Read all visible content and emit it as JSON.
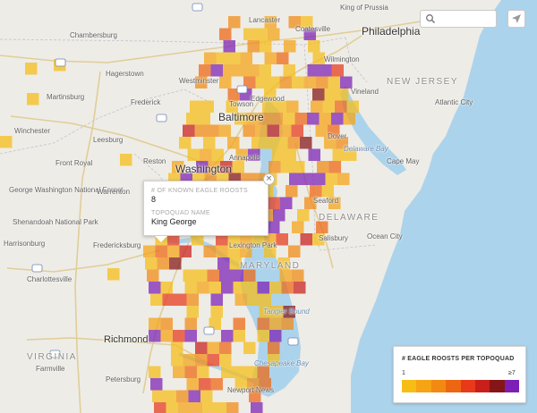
{
  "search": {
    "placeholder": ""
  },
  "popup": {
    "count_label": "# OF KNOWN EAGLE ROOSTS",
    "count_value": "8",
    "name_label": "TOPOQUAD NAME",
    "name_value": "King George",
    "close_symbol": "×"
  },
  "legend": {
    "title": "# EAGLE ROOSTS PER TOPOQUAD",
    "min_label": "1",
    "max_label": "≥7",
    "colors": [
      "#f7bd14",
      "#f6a314",
      "#f28a12",
      "#ee6611",
      "#e8391b",
      "#c91f1b",
      "#851516",
      "#7c1fb5"
    ]
  },
  "places": {
    "philadelphia": "Philadelphia",
    "lancaster": "Lancaster",
    "coatesville": "Coatesville",
    "chambersburg": "Chambersburg",
    "hagerstown": "Hagerstown",
    "westminster": "Westminster",
    "edgewood": "Edgewood",
    "baltimore": "Baltimore",
    "towson": "Towson",
    "martinsburg": "Martinsburg",
    "frederick": "Frederick",
    "winchester": "Winchester",
    "leesburg": "Leesburg",
    "front_royal": "Front Royal",
    "washington": "Washington",
    "reston": "Reston",
    "annapolis": "Annapolis",
    "dover": "Dover",
    "delaware_bay": "Delaware Bay",
    "new_jersey": "NEW JERSEY",
    "wilmington": "Wilmington",
    "vineland": "Vineland",
    "atlantic_city": "Atlantic City",
    "cape_may": "Cape May",
    "george_washington_nf": "George Washington National Forest",
    "shenandoah": "Shenandoah National Park",
    "warrenton": "Warrenton",
    "fredericksburg": "Fredericksburg",
    "charlottesville": "Charlottesville",
    "harrisonburg": "Harrisonburg",
    "lexington_park": "Lexington Park",
    "maryland": "MARYLAND",
    "delaware": "DELAWARE",
    "seaford": "Seaford",
    "salisbury": "Salisbury",
    "ocean_city": "Ocean City",
    "tangier": "Tangier Sound",
    "richmond": "Richmond",
    "virginia": "VIRGINIA",
    "farmville": "Farmville",
    "petersburg": "Petersburg",
    "newport_news": "Newport News",
    "chesapeake_bay": "Chesapeake Bay",
    "king_of_prussia": "King of Prussia"
  }
}
